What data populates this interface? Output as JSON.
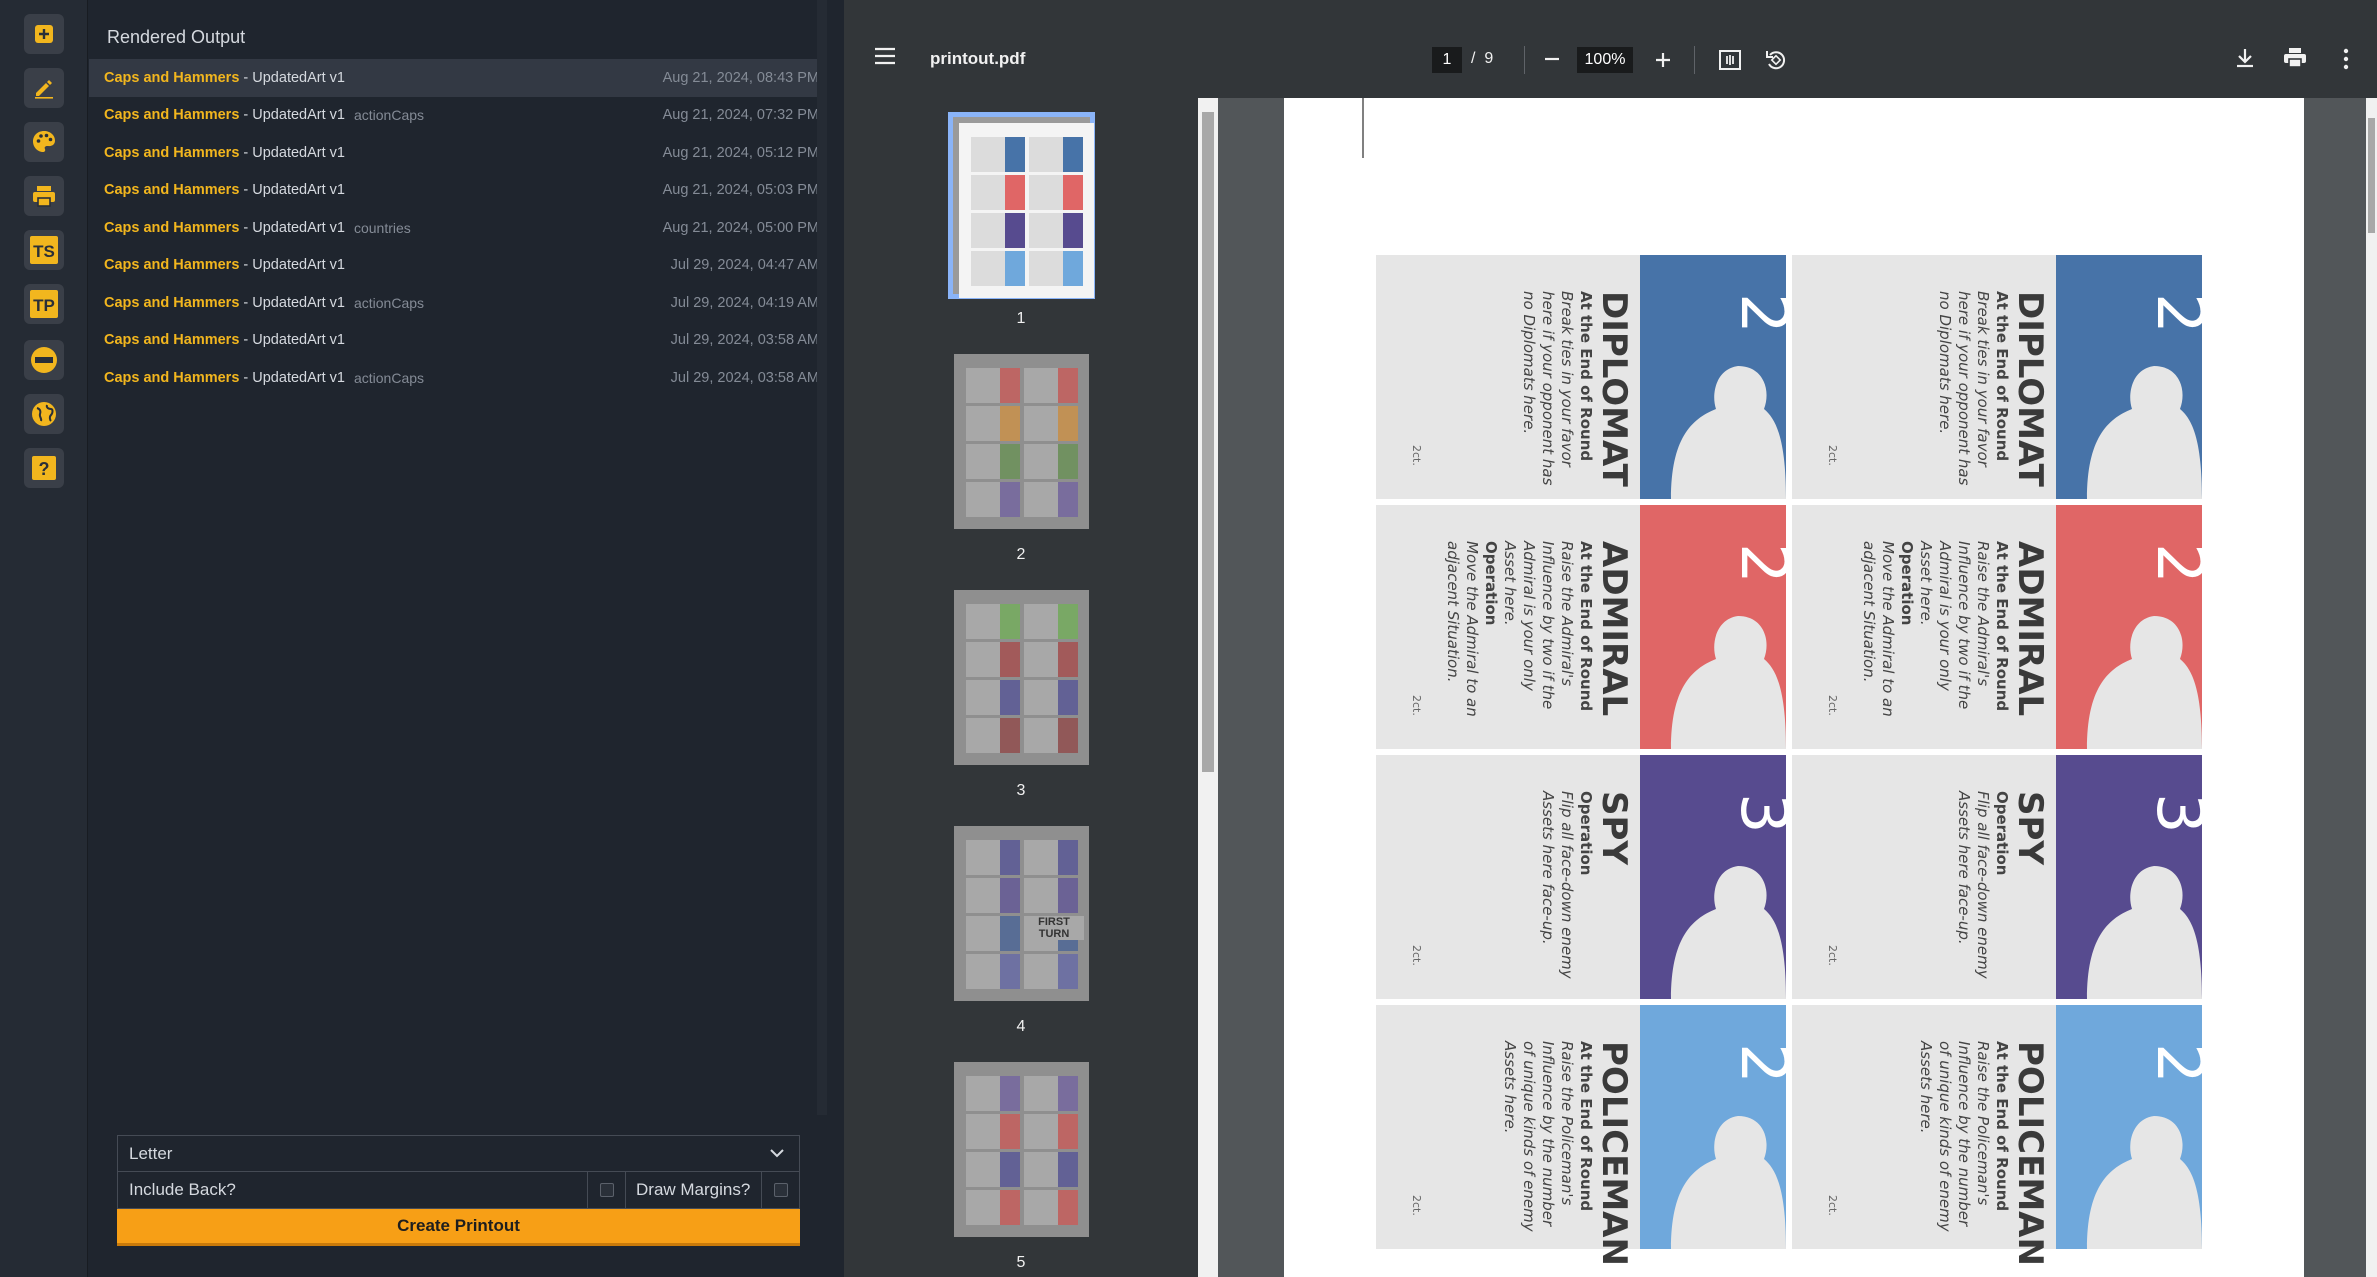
{
  "rail": {
    "icons": [
      "plus-icon",
      "pencil-icon",
      "palette-icon",
      "printer-icon",
      "ts-icon",
      "tp-icon",
      "badge-icon",
      "globe-icon",
      "help-icon"
    ],
    "accent": "#f2b61e"
  },
  "panel": {
    "title": "Rendered Output",
    "items": [
      {
        "name": "Caps and Hammers",
        "mid": " - UpdatedArt v1",
        "tag": "",
        "date": "Aug 21, 2024, 08:43 PM"
      },
      {
        "name": "Caps and Hammers",
        "mid": " - UpdatedArt v1",
        "tag": "actionCaps",
        "date": "Aug 21, 2024, 07:32 PM"
      },
      {
        "name": "Caps and Hammers",
        "mid": " - UpdatedArt v1",
        "tag": "",
        "date": "Aug 21, 2024, 05:12 PM"
      },
      {
        "name": "Caps and Hammers",
        "mid": " - UpdatedArt v1",
        "tag": "",
        "date": "Aug 21, 2024, 05:03 PM"
      },
      {
        "name": "Caps and Hammers",
        "mid": " - UpdatedArt v1",
        "tag": "countries",
        "date": "Aug 21, 2024, 05:00 PM"
      },
      {
        "name": "Caps and Hammers",
        "mid": " - UpdatedArt v1",
        "tag": "",
        "date": "Jul 29, 2024, 04:47 AM"
      },
      {
        "name": "Caps and Hammers",
        "mid": " - UpdatedArt v1",
        "tag": "actionCaps",
        "date": "Jul 29, 2024, 04:19 AM"
      },
      {
        "name": "Caps and Hammers",
        "mid": " - UpdatedArt v1",
        "tag": "",
        "date": "Jul 29, 2024, 03:58 AM"
      },
      {
        "name": "Caps and Hammers",
        "mid": " - UpdatedArt v1",
        "tag": "actionCaps",
        "date": "Jul 29, 2024, 03:58 AM"
      }
    ],
    "paper_size": "Letter",
    "include_back_label": "Include Back?",
    "draw_margins_label": "Draw Margins?",
    "create_label": "Create Printout"
  },
  "viewer": {
    "file_name": "printout.pdf",
    "page_current": "1",
    "page_total": "/  9",
    "zoom": "100%",
    "thumbnails": [
      "1",
      "2",
      "3",
      "4",
      "5"
    ],
    "thumb_4_text": [
      "FIRST",
      "TURN"
    ]
  },
  "cards": {
    "tier_label": "2ct.",
    "list": [
      {
        "name": "DIPLOMAT",
        "value": "2",
        "color": "#4773a8",
        "head": "At the End of Round",
        "body": [
          "Break ties in your favor",
          "here if your opponent has",
          "no Diplomats here."
        ]
      },
      {
        "name": "ADMIRAL",
        "value": "2",
        "color": "#e06666",
        "head": "At the End of Round",
        "body": [
          "Raise the Admiral's",
          "Influence by two if the",
          "Admiral is your only",
          "Asset here."
        ],
        "head2": "Operation",
        "body2": [
          "Move the Admiral to an",
          "adjacent Situation."
        ]
      },
      {
        "name": "SPY",
        "value": "3",
        "color": "#574b8f",
        "head": "Operation",
        "body": [
          "Flip all face-down enemy",
          "Assets here face-up."
        ]
      },
      {
        "name": "POLICEMAN",
        "value": "2",
        "color": "#6fa8dc",
        "head": "At the End of Round",
        "body": [
          "Raise the Policeman's",
          "Influence by the number",
          "of unique kinds of enemy",
          "Assets here."
        ]
      }
    ]
  }
}
